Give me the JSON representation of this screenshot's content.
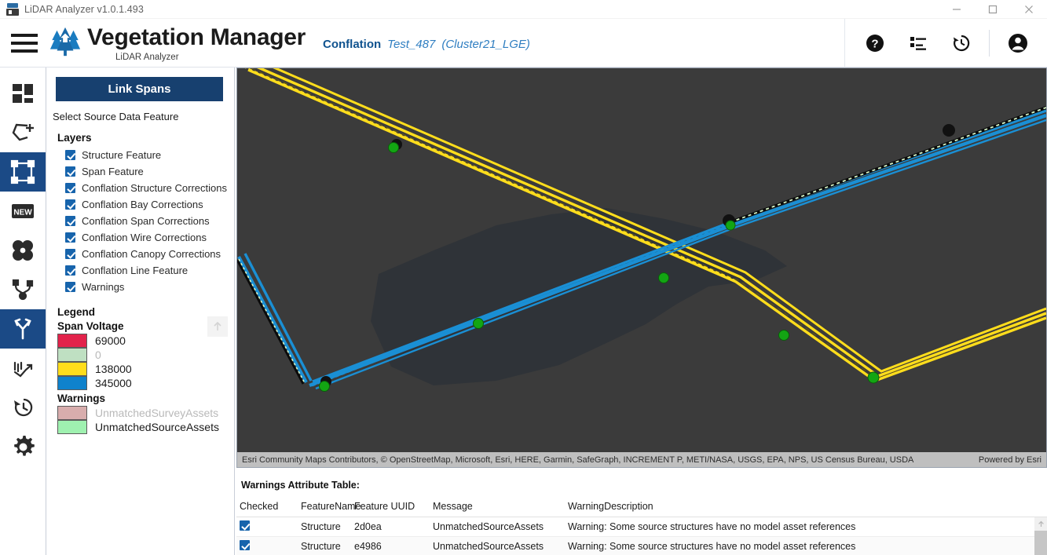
{
  "window": {
    "title": "LiDAR Analyzer v1.0.1.493",
    "app_icon": "lidar-app-icon",
    "minimize": "—",
    "maximize": "☐",
    "close": "✕"
  },
  "header": {
    "menu_icon": "hamburger-menu-icon",
    "logo_icon": "trees-logo-icon",
    "brand_title": "Vegetation Manager",
    "brand_subtitle": "LiDAR Analyzer",
    "breadcrumb": {
      "section": "Conflation",
      "project": "Test_487",
      "cluster": "(Cluster21_LGE)"
    },
    "actions": [
      {
        "name": "help-icon",
        "glyph": "?"
      },
      {
        "name": "list-settings-icon",
        "glyph": "list"
      },
      {
        "name": "history-icon",
        "glyph": "history"
      },
      {
        "name": "account-icon",
        "glyph": "person"
      }
    ]
  },
  "rail": {
    "items": [
      {
        "name": "dashboard-icon",
        "active": false
      },
      {
        "name": "add-polygon-icon",
        "active": false
      },
      {
        "name": "select-extent-icon",
        "active": true
      },
      {
        "name": "new-badge-icon",
        "active": false
      },
      {
        "name": "canopy-icon",
        "active": false
      },
      {
        "name": "network-branch-icon",
        "active": false
      },
      {
        "name": "conflation-merge-icon",
        "active": true
      },
      {
        "name": "analytics-icon",
        "active": false
      },
      {
        "name": "history-icon",
        "active": false
      },
      {
        "name": "settings-gear-icon",
        "active": false
      }
    ]
  },
  "panel": {
    "link_spans_label": "Link Spans",
    "select_prompt": "Select Source Data Feature",
    "layers_heading": "Layers",
    "layers": [
      {
        "label": "Structure Feature",
        "checked": true
      },
      {
        "label": "Span Feature",
        "checked": true
      },
      {
        "label": "Conflation Structure Corrections",
        "checked": true
      },
      {
        "label": "Conflation Bay Corrections",
        "checked": true
      },
      {
        "label": "Conflation Span Corrections",
        "checked": true
      },
      {
        "label": "Conflation Wire Corrections",
        "checked": true
      },
      {
        "label": "Conflation Canopy Corrections",
        "checked": true
      },
      {
        "label": "Conflation Line Feature",
        "checked": true
      },
      {
        "label": "Warnings",
        "checked": true
      }
    ],
    "legend_heading": "Legend",
    "legend_groups": [
      {
        "title": "Span Voltage",
        "entries": [
          {
            "label": "69000",
            "color": "#e2234b",
            "muted": false
          },
          {
            "label": "0",
            "color": "#bfe0c2",
            "muted": true
          },
          {
            "label": "138000",
            "color": "#ffdd1c",
            "muted": false
          },
          {
            "label": "345000",
            "color": "#0f82cc",
            "muted": false
          }
        ]
      },
      {
        "title": "Warnings",
        "entries": [
          {
            "label": "UnmatchedSurveyAssets",
            "color": "#d8adad",
            "muted": true
          },
          {
            "label": "UnmatchedSourceAssets",
            "color": "#9ff1b0",
            "muted": false
          }
        ]
      }
    ],
    "scroll_up_icon": "arrow-up-icon"
  },
  "map": {
    "attribution": "Esri Community Maps Contributors, © OpenStreetMap, Microsoft, Esri, HERE, Garmin, SafeGraph, INCREMENT P, METI/NASA, USGS, EPA, NPS, US Census Bureau, USDA",
    "powered_by": "Powered by Esri",
    "basemap_color": "#3b3b3b",
    "landmass_color": "#2f3338",
    "voltage_yellow": "#ffdd1c",
    "voltage_blue": "#1a8fd4",
    "structure_marker_color": "#111111",
    "unmatched_marker_color": "#13a513"
  },
  "table": {
    "title": "Warnings Attribute Table:",
    "columns": [
      "Checked",
      "FeatureName",
      "Feature UUID",
      "Message",
      "WarningDescription"
    ],
    "rows": [
      {
        "checked": true,
        "feature_name": "Structure",
        "uuid": "2d0ea",
        "message": "UnmatchedSourceAssets",
        "description": "Warning: Some source structures have no model asset references"
      },
      {
        "checked": true,
        "feature_name": "Structure",
        "uuid": "e4986",
        "message": "UnmatchedSourceAssets",
        "description": "Warning: Some source structures have no model asset references"
      }
    ],
    "scroll_up_icon": "arrow-up-icon"
  }
}
